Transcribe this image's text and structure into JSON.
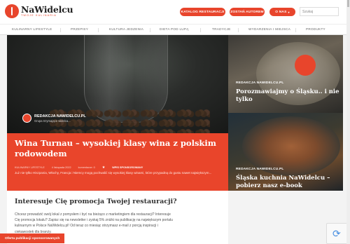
{
  "header": {
    "logo_name": "NaWidelcu",
    "logo_tagline": "TWOJE KULINARIA",
    "btn_catalog": "KATALOG RESTAURACJI",
    "btn_author": "ZOSTAŃ AUTOREM",
    "btn_about": "O NAS",
    "search_placeholder": "Szukaj"
  },
  "nav": {
    "items": [
      "KULINARNY LIFESTYLE",
      "PRZEPISY",
      "KULTURA JEDZENIA",
      "DIETA POD LUPĄ",
      "TRADYCJE",
      "WYDARZENIA I MIEJSCA",
      "PRODUKTY"
    ]
  },
  "hero": {
    "author": "REDAKCJA NAWIDELCU.PL",
    "author_sub": "Grupa trzymające widelca...",
    "title": "Wina Turnau – wysokiej klasy wina z polskim rodowodem",
    "meta_category": "KULINARNY LIFESTYLE",
    "meta_date": "4 listopada 2022",
    "meta_comments": "komentarze: 0",
    "meta_sponsored": "WPIS SPONSOROWANY",
    "excerpt": "Już nie tylko Hiszpania, Włochy, Francja i Niemcy mogą pochwalić się wysokiej klasy winami, które przypadną do gustu nawet największym..."
  },
  "cards": [
    {
      "label": "REDAKCJA NAWIDELCU.PL",
      "title": "Porozmawiajmy o Śląsku.. i nie tylko"
    },
    {
      "label": "REDAKCJA NAWIDELCU.PL",
      "title": "Śląska kuchnia NaWidelcu – pobierz nasz e-book"
    }
  ],
  "promo": {
    "title": "Interesuje Cię promocja Twojej restauracji?",
    "text": "Chcesz prowadzić swój lokal z pomysłem i być na bieżąco z marketingiem dla restauracji? Interesuje Cię promocja lokalu? Zapisz się na newsletter i zyskaj 5% zniżki na publikację na największym portalu kulinarnym w Polsce NaWidelcu.pl! Od teraz co miesiąc otrzymasz e-mail z porcją inspiracji i ciekawostek dla branży."
  },
  "sponsor_button": "Oferta publikacji sponsorowanych",
  "colors": {
    "accent": "#e8452c"
  }
}
